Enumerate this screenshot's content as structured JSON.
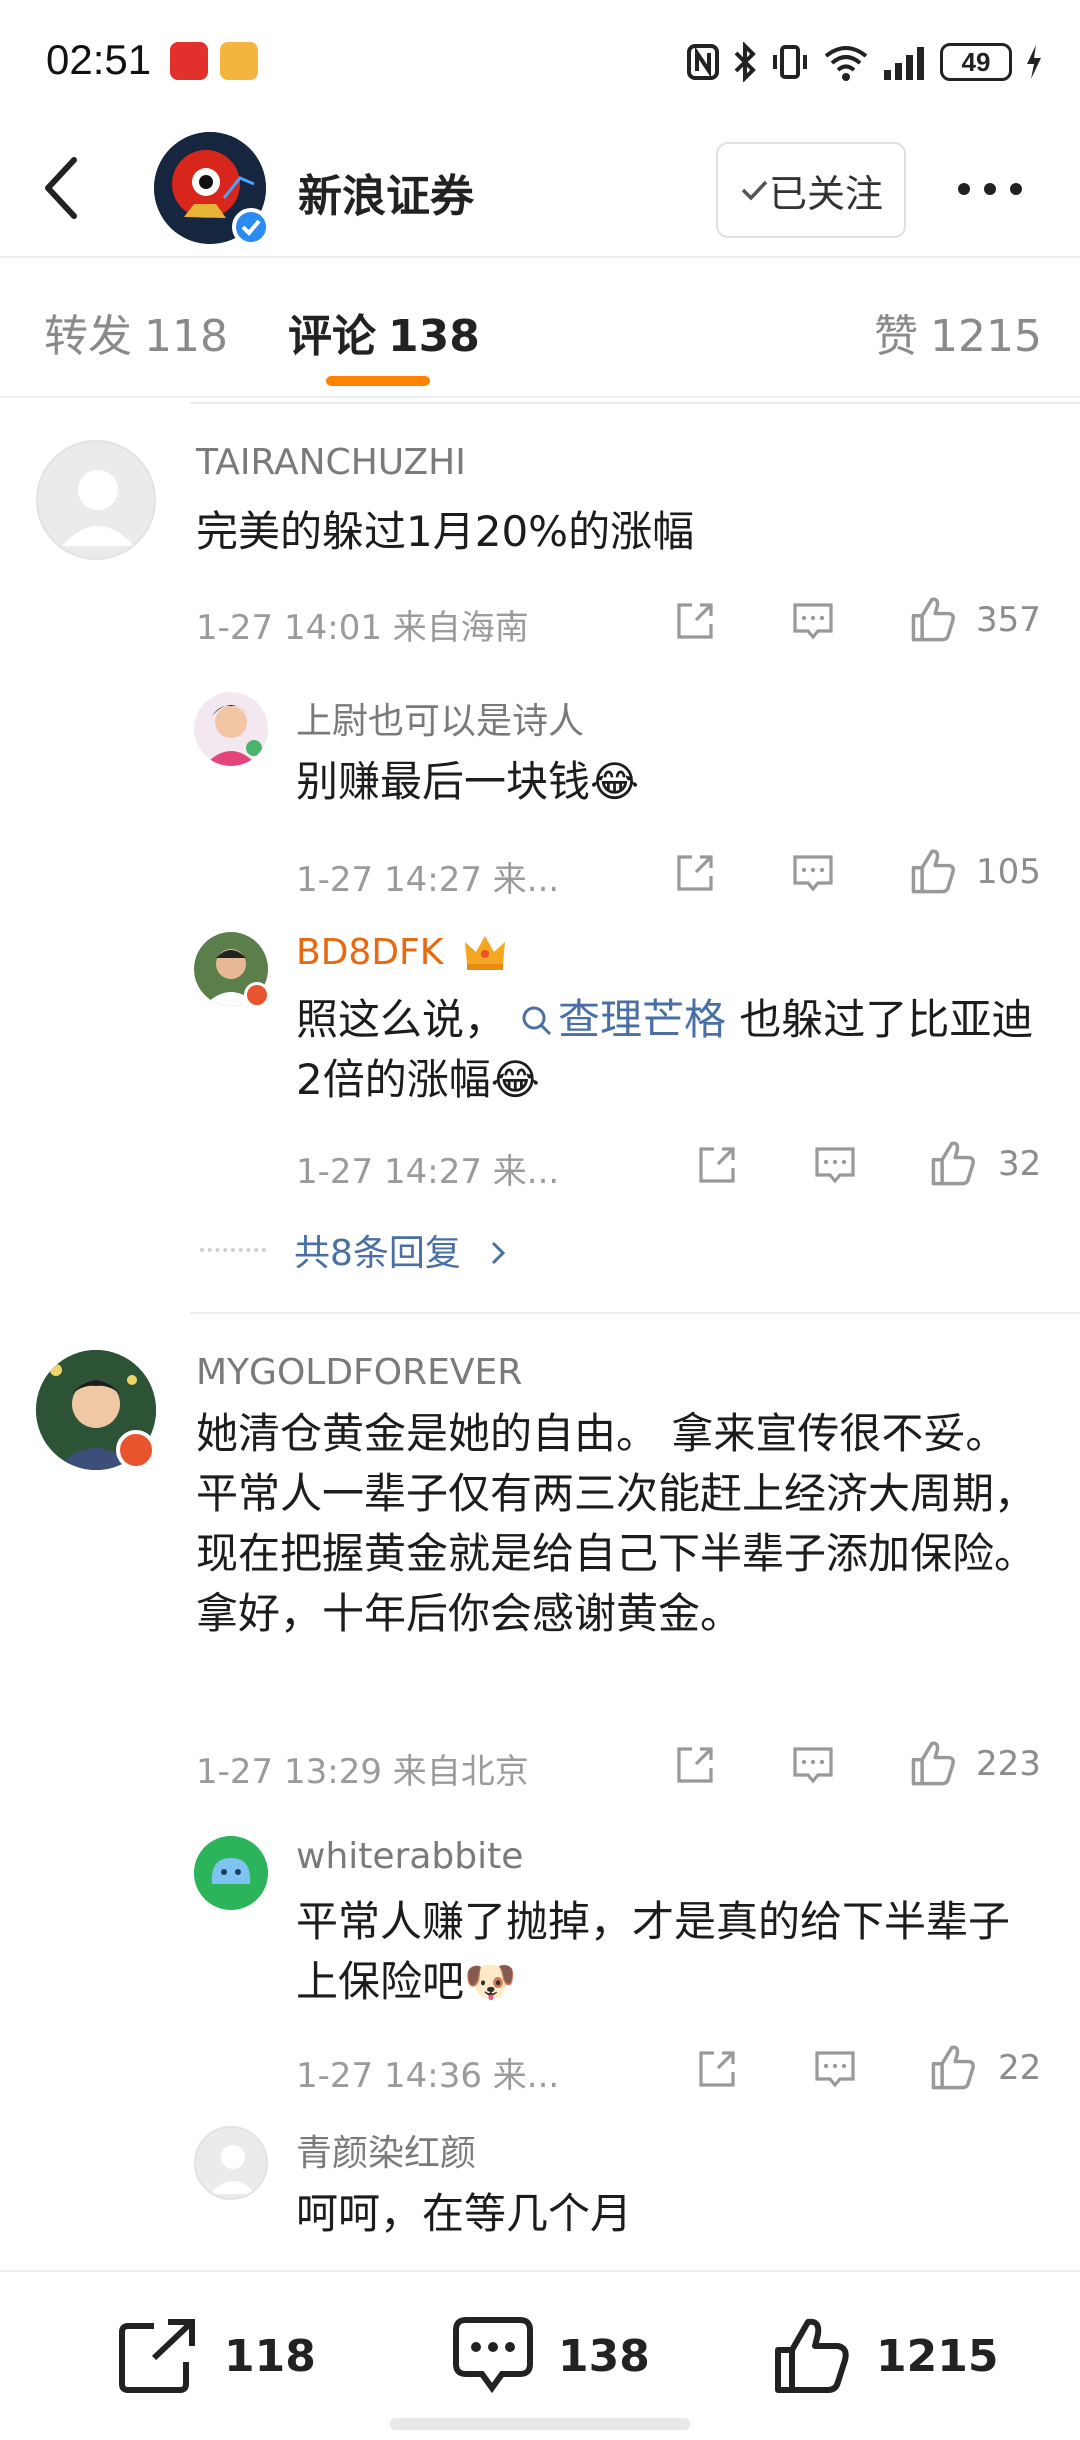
{
  "status_bar": {
    "time": "02:51",
    "battery": "49"
  },
  "header": {
    "title": "新浪证券",
    "follow_label": "已关注"
  },
  "tabs": [
    {
      "label": "转发",
      "count": "118"
    },
    {
      "label": "评论",
      "count": "138"
    },
    {
      "label": "赞",
      "count": "1215"
    }
  ],
  "comments": [
    {
      "user": "TAIRANCHUZHI",
      "text": "完美的躲过1月20%的涨幅",
      "meta": "1-27 14:01 来自海南",
      "likes": "357",
      "replies": [
        {
          "user": "上尉也可以是诗人",
          "text": "别赚最后一块钱😂",
          "meta": "1-27 14:27 来...",
          "likes": "105"
        },
        {
          "user": "BD8DFK",
          "text_a": "照这么说，",
          "topic": "查理芒格",
          "text_b": " 也躲过了比亚迪2倍的涨幅😂",
          "meta": "1-27 14:27 来...",
          "likes": "32"
        }
      ],
      "more_replies": "共8条回复"
    },
    {
      "user": "MYGOLDFOREVER",
      "text": "她清仓黄金是她的自由。 拿来宣传很不妥。平常人一辈子仅有两三次能赶上经济大周期，现在把握黄金就是给自己下半辈子添加保险。拿好，十年后你会感谢黄金。",
      "meta": "1-27 13:29 来自北京",
      "likes": "223",
      "replies": [
        {
          "user": "whiterabbite",
          "text": "平常人赚了抛掉，才是真的给下半辈子上保险吧🐶",
          "meta": "1-27 14:36 来...",
          "likes": "22"
        },
        {
          "user": "青颜染红颜",
          "text": "呵呵，在等几个月"
        }
      ]
    }
  ],
  "bottom_bar": {
    "repost": "118",
    "comment": "138",
    "like": "1215"
  },
  "colors": {
    "accent": "#ff8200",
    "link": "#4a6fa5",
    "vip_name": "#e8690f"
  }
}
